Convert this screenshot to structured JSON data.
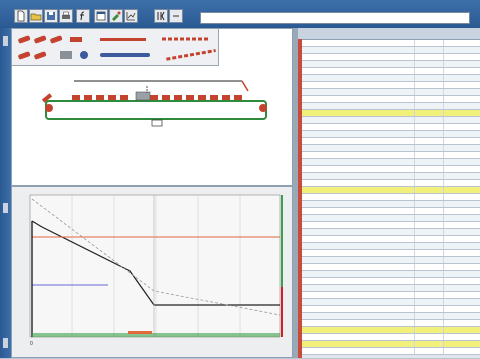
{
  "toolbar": {
    "buttons": [
      {
        "name": "new-file-button",
        "icon": "new-file-icon"
      },
      {
        "name": "open-folder-button",
        "icon": "folder-icon"
      },
      {
        "name": "save-button",
        "icon": "floppy-disk-icon"
      },
      {
        "name": "print-button",
        "icon": "printer-icon"
      },
      {
        "name": "properties-button",
        "icon": "f-function-icon"
      },
      {
        "name": "view-button",
        "icon": "window-icon"
      },
      {
        "name": "tool-button",
        "icon": "tool-icon"
      },
      {
        "name": "chart-button",
        "icon": "chart-icon"
      },
      {
        "name": "run-button",
        "icon": "run-icon"
      },
      {
        "name": "more-button",
        "icon": "more-icon"
      }
    ],
    "field_value": ""
  },
  "colors": {
    "titlebar": "#2b5a93",
    "conveyor_red": "#c4432e",
    "conveyor_green": "#2e8b3c",
    "line_black": "#222222",
    "line_orange": "#e06a3c",
    "line_blue": "#6a6ad8",
    "line_gray": "#9a9a9a",
    "line_green": "#3ca04a",
    "line_red": "#d02020",
    "section_yellow": "#f1f07a"
  },
  "chart": {
    "xticks": [
      "0",
      "",
      "",
      "",
      "",
      "",
      ""
    ],
    "yticks_left": [
      "",
      "",
      "",
      "",
      "",
      "",
      ""
    ],
    "yticks_right": [
      "",
      "",
      "",
      "",
      "",
      "",
      ""
    ],
    "xlabel": ""
  },
  "props": {
    "header": [
      "",
      "",
      ""
    ],
    "rows": [
      {
        "type": "normal",
        "c1": "",
        "c2": "",
        "c3": ""
      },
      {
        "type": "normal",
        "c1": "",
        "c2": "",
        "c3": ""
      },
      {
        "type": "normal",
        "c1": "",
        "c2": "",
        "c3": ""
      },
      {
        "type": "normal",
        "c1": "",
        "c2": "",
        "c3": ""
      },
      {
        "type": "normal",
        "c1": "",
        "c2": "",
        "c3": ""
      },
      {
        "type": "normal",
        "c1": "",
        "c2": "",
        "c3": ""
      },
      {
        "type": "normal",
        "c1": "",
        "c2": "",
        "c3": ""
      },
      {
        "type": "normal",
        "c1": "",
        "c2": "",
        "c3": ""
      },
      {
        "type": "normal",
        "c1": "",
        "c2": "",
        "c3": ""
      },
      {
        "type": "normal",
        "c1": "",
        "c2": "",
        "c3": ""
      },
      {
        "type": "section",
        "c1": "",
        "c2": "",
        "c3": ""
      },
      {
        "type": "normal",
        "c1": "",
        "c2": "",
        "c3": ""
      },
      {
        "type": "normal",
        "c1": "",
        "c2": "",
        "c3": ""
      },
      {
        "type": "normal",
        "c1": "",
        "c2": "",
        "c3": ""
      },
      {
        "type": "normal",
        "c1": "",
        "c2": "",
        "c3": ""
      },
      {
        "type": "normal",
        "c1": "",
        "c2": "",
        "c3": ""
      },
      {
        "type": "normal",
        "c1": "",
        "c2": "",
        "c3": ""
      },
      {
        "type": "normal",
        "c1": "",
        "c2": "",
        "c3": ""
      },
      {
        "type": "normal",
        "c1": "",
        "c2": "",
        "c3": ""
      },
      {
        "type": "normal",
        "c1": "",
        "c2": "",
        "c3": ""
      },
      {
        "type": "normal",
        "c1": "",
        "c2": "",
        "c3": ""
      },
      {
        "type": "section",
        "c1": "",
        "c2": "",
        "c3": ""
      },
      {
        "type": "normal",
        "c1": "",
        "c2": "",
        "c3": ""
      },
      {
        "type": "normal",
        "c1": "",
        "c2": "",
        "c3": ""
      },
      {
        "type": "normal",
        "c1": "",
        "c2": "",
        "c3": ""
      },
      {
        "type": "normal",
        "c1": "",
        "c2": "",
        "c3": ""
      },
      {
        "type": "normal",
        "c1": "",
        "c2": "",
        "c3": ""
      },
      {
        "type": "normal",
        "c1": "",
        "c2": "",
        "c3": ""
      },
      {
        "type": "normal",
        "c1": "",
        "c2": "",
        "c3": ""
      },
      {
        "type": "normal",
        "c1": "",
        "c2": "",
        "c3": ""
      },
      {
        "type": "normal",
        "c1": "",
        "c2": "",
        "c3": ""
      },
      {
        "type": "normal",
        "c1": "",
        "c2": "",
        "c3": ""
      },
      {
        "type": "normal",
        "c1": "",
        "c2": "",
        "c3": ""
      },
      {
        "type": "normal",
        "c1": "",
        "c2": "",
        "c3": ""
      },
      {
        "type": "normal",
        "c1": "",
        "c2": "",
        "c3": ""
      },
      {
        "type": "normal",
        "c1": "",
        "c2": "",
        "c3": ""
      },
      {
        "type": "normal",
        "c1": "",
        "c2": "",
        "c3": ""
      },
      {
        "type": "normal",
        "c1": "",
        "c2": "",
        "c3": ""
      },
      {
        "type": "normal",
        "c1": "",
        "c2": "",
        "c3": ""
      },
      {
        "type": "normal",
        "c1": "",
        "c2": "",
        "c3": ""
      },
      {
        "type": "normal",
        "c1": "",
        "c2": "",
        "c3": ""
      },
      {
        "type": "section",
        "c1": "",
        "c2": "",
        "c3": ""
      },
      {
        "type": "normal",
        "c1": "",
        "c2": "",
        "c3": ""
      },
      {
        "type": "section",
        "c1": "",
        "c2": "",
        "c3": ""
      },
      {
        "type": "normal",
        "c1": "",
        "c2": "",
        "c3": ""
      }
    ]
  }
}
